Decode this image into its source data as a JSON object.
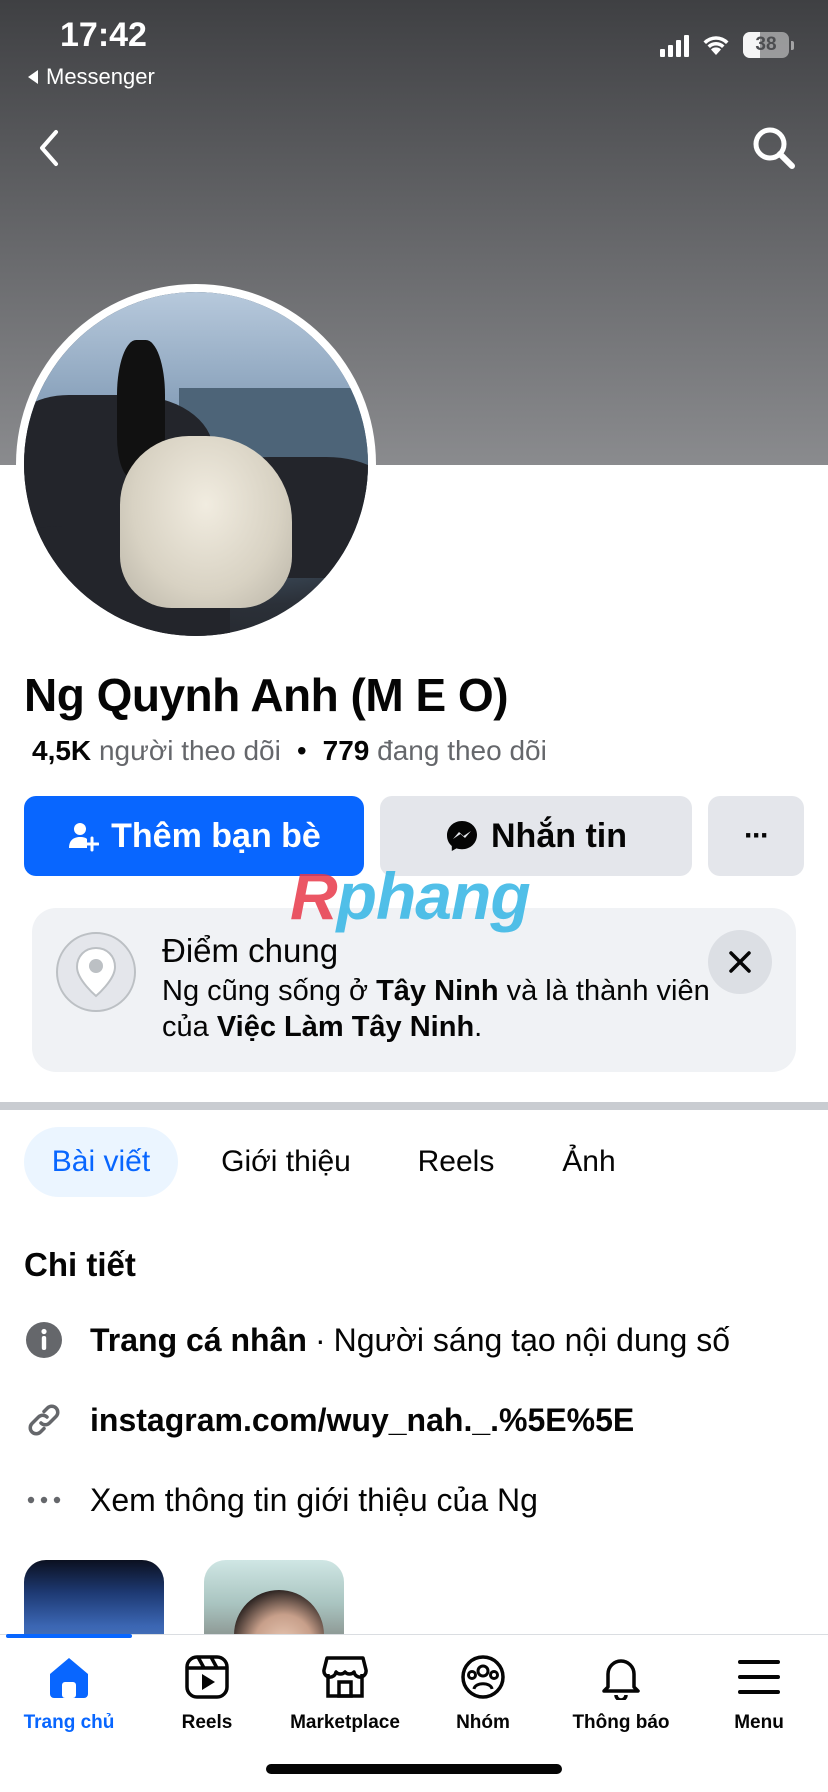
{
  "status_bar": {
    "time": "17:42",
    "back_app": "Messenger",
    "battery": "38",
    "battery_level": 0.38
  },
  "profile": {
    "name": "Ng Quynh Anh (M E O)",
    "followers_count": "4,5K",
    "followers_label": "người theo dõi",
    "following_count": "779",
    "following_label": "đang theo dõi",
    "stats_separator": "•"
  },
  "actions": {
    "add_friend": "Thêm bạn bè",
    "message": "Nhắn tin",
    "more": "···"
  },
  "watermark": {
    "part1": "R",
    "part2": "phang"
  },
  "common": {
    "title": "Điểm chung",
    "text_1": "Ng cũng sống ở ",
    "place": "Tây Ninh",
    "text_2": " và là thành viên của ",
    "group": "Việc Làm Tây Ninh",
    "text_3": "."
  },
  "tabs": {
    "posts": "Bài viết",
    "about": "Giới thiệu",
    "reels": "Reels",
    "photos": "Ảnh"
  },
  "details": {
    "title": "Chi tiết",
    "profile_type_label": "Trang cá nhân",
    "separator": "·",
    "profile_type_value": "Người sáng tạo nội dung số",
    "link": "instagram.com/wuy_nah._.%5E%5E",
    "see_about": "Xem thông tin giới thiệu của Ng"
  },
  "bottom_nav": {
    "home": "Trang chủ",
    "reels": "Reels",
    "marketplace": "Marketplace",
    "groups": "Nhóm",
    "notifications": "Thông báo",
    "menu": "Menu"
  },
  "colors": {
    "accent": "#0866ff",
    "button_secondary": "#e4e6eb",
    "text_secondary": "#65676b"
  }
}
